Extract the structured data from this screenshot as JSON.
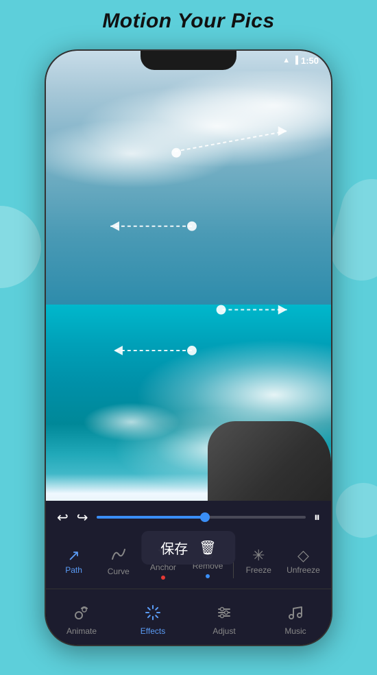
{
  "app": {
    "title": "Motion Your Pics",
    "status_bar": {
      "time": "1:50",
      "wifi": "▲",
      "battery": "▐"
    }
  },
  "photo": {
    "alt": "Ocean waves with cloudy sky"
  },
  "playback": {
    "progress_percent": 52,
    "undo_label": "↩",
    "redo_label": "↪",
    "pause_label": "⏸"
  },
  "save_tooltip": {
    "label": "保存",
    "delete_icon": "🗑"
  },
  "primary_toolbar": {
    "buttons": [
      {
        "id": "path",
        "icon": "↗",
        "label": "Path",
        "active": true,
        "dot": null
      },
      {
        "id": "curve",
        "icon": "〜",
        "label": "Curve",
        "active": false,
        "dot": null
      },
      {
        "id": "anchor",
        "icon": "✦",
        "label": "Anchor",
        "active": false,
        "dot": "red"
      },
      {
        "id": "remove",
        "icon": "🗑",
        "label": "Remove",
        "active": false,
        "dot": "blue"
      },
      {
        "id": "freeze",
        "icon": "✳",
        "label": "Freeze",
        "active": false,
        "dot": null
      },
      {
        "id": "unfreeze",
        "icon": "◇",
        "label": "Unfreeze",
        "active": false,
        "dot": null
      }
    ]
  },
  "bottom_nav": {
    "items": [
      {
        "id": "animate",
        "icon": "⊙",
        "label": "Animate",
        "active": false
      },
      {
        "id": "effects",
        "icon": "✳",
        "label": "Effects",
        "active": true
      },
      {
        "id": "adjust",
        "icon": "≡",
        "label": "Adjust",
        "active": false
      },
      {
        "id": "music",
        "icon": "♫",
        "label": "Music",
        "active": false
      }
    ]
  }
}
